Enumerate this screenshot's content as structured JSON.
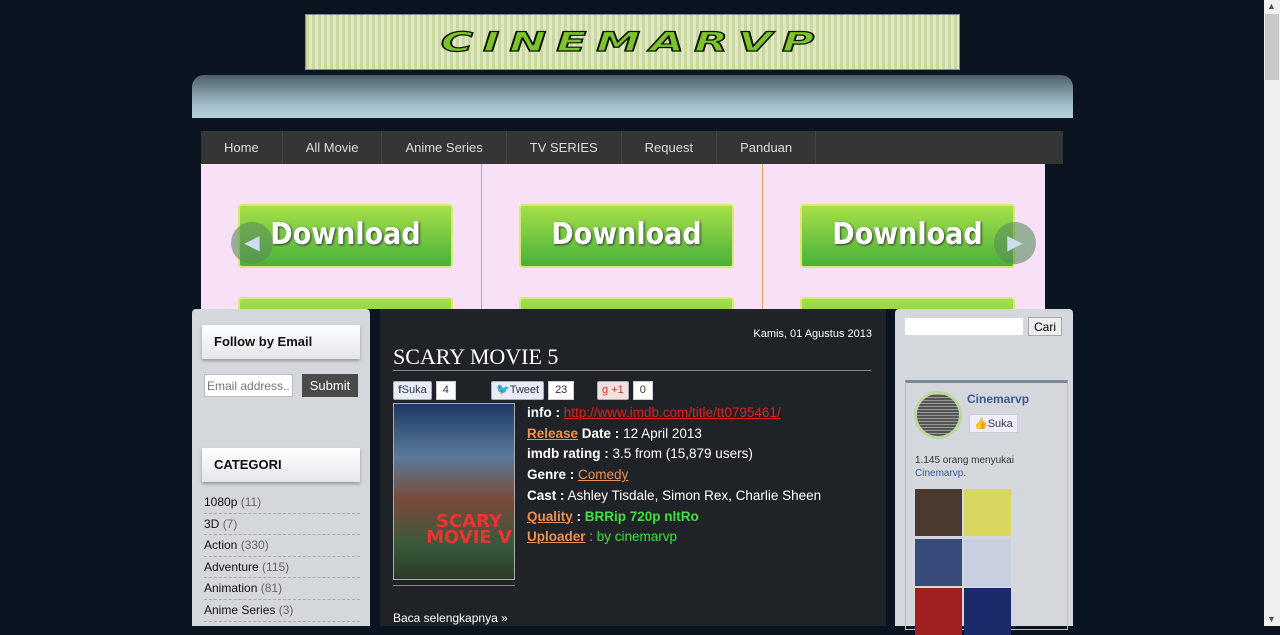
{
  "logo_text": "CINEMARVP",
  "nav": [
    "Home",
    "All Movie",
    "Anime Series",
    "TV SERIES",
    "Request",
    "Panduan"
  ],
  "slider": {
    "button_label": "Download",
    "prev": "◀",
    "next": "▶"
  },
  "left_sidebar": {
    "follow_title": "Follow by Email",
    "email_placeholder": "Email address...",
    "submit": "Submit",
    "categories_title": "CATEGORI",
    "categories": [
      {
        "name": "1080p",
        "count": "(11)"
      },
      {
        "name": "3D",
        "count": "(7)"
      },
      {
        "name": "Action",
        "count": "(330)"
      },
      {
        "name": "Adventure",
        "count": "(115)"
      },
      {
        "name": "Animation",
        "count": "(81)"
      },
      {
        "name": "Anime Series",
        "count": "(3)"
      }
    ]
  },
  "post": {
    "date": "Kamis, 01 Agustus 2013",
    "title": "SCARY MOVIE 5",
    "share": {
      "fb_label": "Suka",
      "fb_count": "4",
      "tw_label": "Tweet",
      "tw_count": "23",
      "gp_label": "+1",
      "gp_count": "0"
    },
    "poster_text": "SCARY MOVIE V",
    "info_label": "info :",
    "info_url": "http://www.imdb.com/title/tt0795461/",
    "release_link": "Release",
    "release_label": " Date : ",
    "release_value": " 12 April 2013",
    "rating_label": "imdb rating :",
    "rating_value": " 3.5 from (15,879 users)",
    "genre_label": "Genre :",
    "genre_value": "Comedy",
    "cast_label": "Cast :",
    "cast_value": " Ashley Tisdale, Simon Rex, Charlie Sheen",
    "quality_link": "Quality",
    "quality_value": "BRRip 720p nltRo",
    "uploader_link": "Uploader",
    "uploader_value": " : by cinemarvp",
    "read_more": "Baca selengkapnya »"
  },
  "right_sidebar": {
    "search_button": "Cari",
    "fb_page": "Cinemarvp",
    "fb_like": "Suka",
    "fb_count_text": "1.145 orang menyukai",
    "fb_count_link": "Cinemarvp"
  },
  "colors": {
    "background": "#0b1521",
    "nav": "#353535",
    "slider_bg": "#f8e0f6",
    "panel": "#d4d7dc",
    "post_bg": "#1f2328",
    "link_orange": "#f09050",
    "quality_green": "#40e040"
  }
}
